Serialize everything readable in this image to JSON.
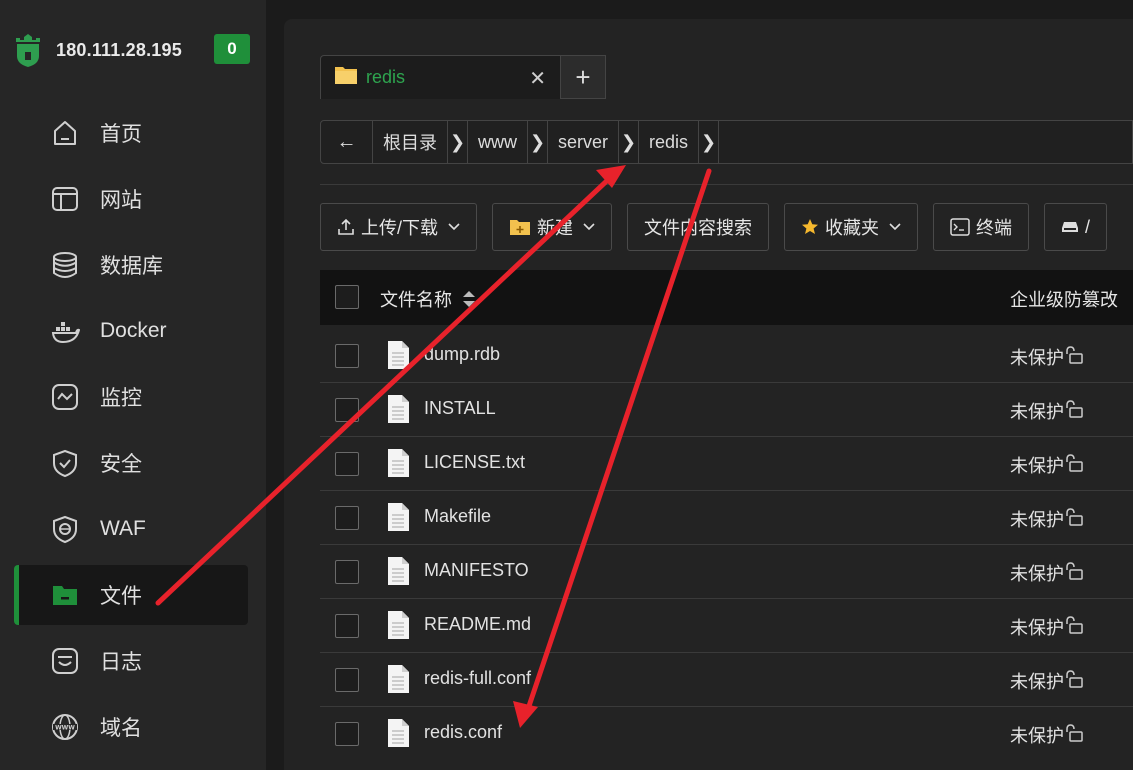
{
  "sidebar": {
    "server_ip": "180.111.28.195",
    "badge_count": "0",
    "accent_color": "#1f8f3a",
    "items": [
      {
        "label": "首页",
        "icon": "home-icon"
      },
      {
        "label": "网站",
        "icon": "website-icon"
      },
      {
        "label": "数据库",
        "icon": "database-icon"
      },
      {
        "label": "Docker",
        "icon": "docker-icon"
      },
      {
        "label": "监控",
        "icon": "monitor-icon"
      },
      {
        "label": "安全",
        "icon": "shield-icon"
      },
      {
        "label": "WAF",
        "icon": "waf-icon"
      },
      {
        "label": "文件",
        "icon": "folder-icon",
        "active": true
      },
      {
        "label": "日志",
        "icon": "log-icon"
      },
      {
        "label": "域名",
        "icon": "domain-icon"
      }
    ]
  },
  "tabs": {
    "items": [
      {
        "label": "redis",
        "icon": "folder-icon"
      }
    ],
    "add_label": "+",
    "close_label": "✕"
  },
  "breadcrumb": {
    "back_label": "←",
    "items": [
      "根目录",
      "www",
      "server",
      "redis"
    ]
  },
  "toolbar": {
    "upload_label": "上传/下载",
    "new_label": "新建",
    "search_label": "文件内容搜索",
    "favorites_label": "收藏夹",
    "terminal_label": "终端",
    "more_label": "/"
  },
  "table": {
    "col_name": "文件名称",
    "col_protection": "企业级防篡改",
    "rows": [
      {
        "name": "dump.rdb",
        "protection": "未保护"
      },
      {
        "name": "INSTALL",
        "protection": "未保护"
      },
      {
        "name": "LICENSE.txt",
        "protection": "未保护"
      },
      {
        "name": "Makefile",
        "protection": "未保护"
      },
      {
        "name": "MANIFESTO",
        "protection": "未保护"
      },
      {
        "name": "README.md",
        "protection": "未保护"
      },
      {
        "name": "redis-full.conf",
        "protection": "未保护"
      },
      {
        "name": "redis.conf",
        "protection": "未保护"
      }
    ]
  },
  "annotation_color": "#e8222b"
}
